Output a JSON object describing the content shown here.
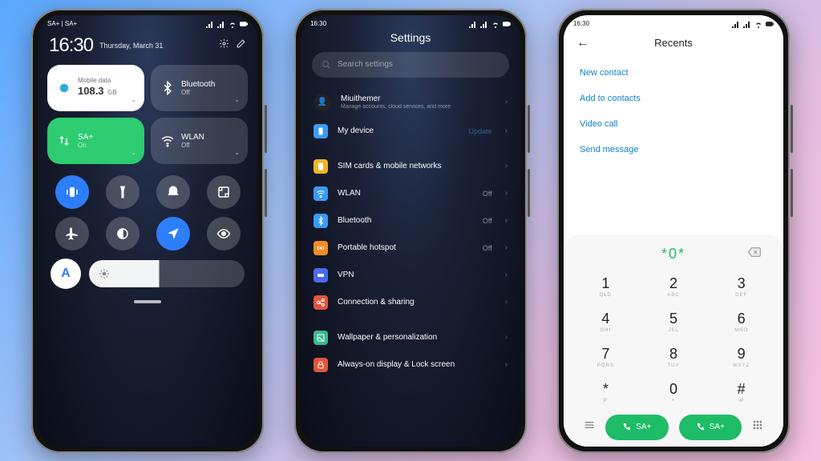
{
  "status": {
    "time": "16:30",
    "sim": "SA+ | SA+"
  },
  "cc": {
    "time": "16:30",
    "date": "Thursday, March 31",
    "tiles": {
      "data": {
        "label": "Mobile data",
        "value": "108.3",
        "unit": "GB"
      },
      "bluetooth": {
        "label": "Bluetooth",
        "sub": "Off"
      },
      "sim": {
        "label": "SA+",
        "sub": "On"
      },
      "wlan": {
        "label": "WLAN",
        "sub": "Off"
      }
    },
    "auto": "A"
  },
  "settings": {
    "title": "Settings",
    "search_placeholder": "Search settings",
    "account": {
      "name": "Miuithemer",
      "sub": "Manage accounts, cloud services, and more"
    },
    "device": {
      "label": "My device",
      "badge": "Update"
    },
    "items": [
      {
        "icon": "sim",
        "color": "#f0b429",
        "label": "SIM cards & mobile networks",
        "val": ""
      },
      {
        "icon": "wifi",
        "color": "#3a9bf4",
        "label": "WLAN",
        "val": "Off"
      },
      {
        "icon": "bt",
        "color": "#3a9bf4",
        "label": "Bluetooth",
        "val": "Off"
      },
      {
        "icon": "hotspot",
        "color": "#f08c29",
        "label": "Portable hotspot",
        "val": "Off"
      },
      {
        "icon": "vpn",
        "color": "#4a6af0",
        "label": "VPN",
        "val": ""
      },
      {
        "icon": "share",
        "color": "#e0563c",
        "label": "Connection & sharing",
        "val": ""
      }
    ],
    "items2": [
      {
        "icon": "wallpaper",
        "color": "#3ab98f",
        "label": "Wallpaper & personalization"
      },
      {
        "icon": "lock",
        "color": "#e0563c",
        "label": "Always-on display & Lock screen"
      }
    ]
  },
  "dialer": {
    "title": "Recents",
    "menu": [
      "New contact",
      "Add to contacts",
      "Video call",
      "Send message"
    ],
    "display": "*0*",
    "keys": [
      {
        "d": "1",
        "l": "QLD"
      },
      {
        "d": "2",
        "l": "ABC"
      },
      {
        "d": "3",
        "l": "DEF"
      },
      {
        "d": "4",
        "l": "GHI"
      },
      {
        "d": "5",
        "l": "JKL"
      },
      {
        "d": "6",
        "l": "MNO"
      },
      {
        "d": "7",
        "l": "PQRS"
      },
      {
        "d": "8",
        "l": "TUV"
      },
      {
        "d": "9",
        "l": "WXYZ"
      },
      {
        "d": "*",
        "l": "P"
      },
      {
        "d": "0",
        "l": "+"
      },
      {
        "d": "#",
        "l": "W"
      }
    ],
    "call": {
      "sim1": "SA+",
      "sim2": "SA+"
    }
  }
}
